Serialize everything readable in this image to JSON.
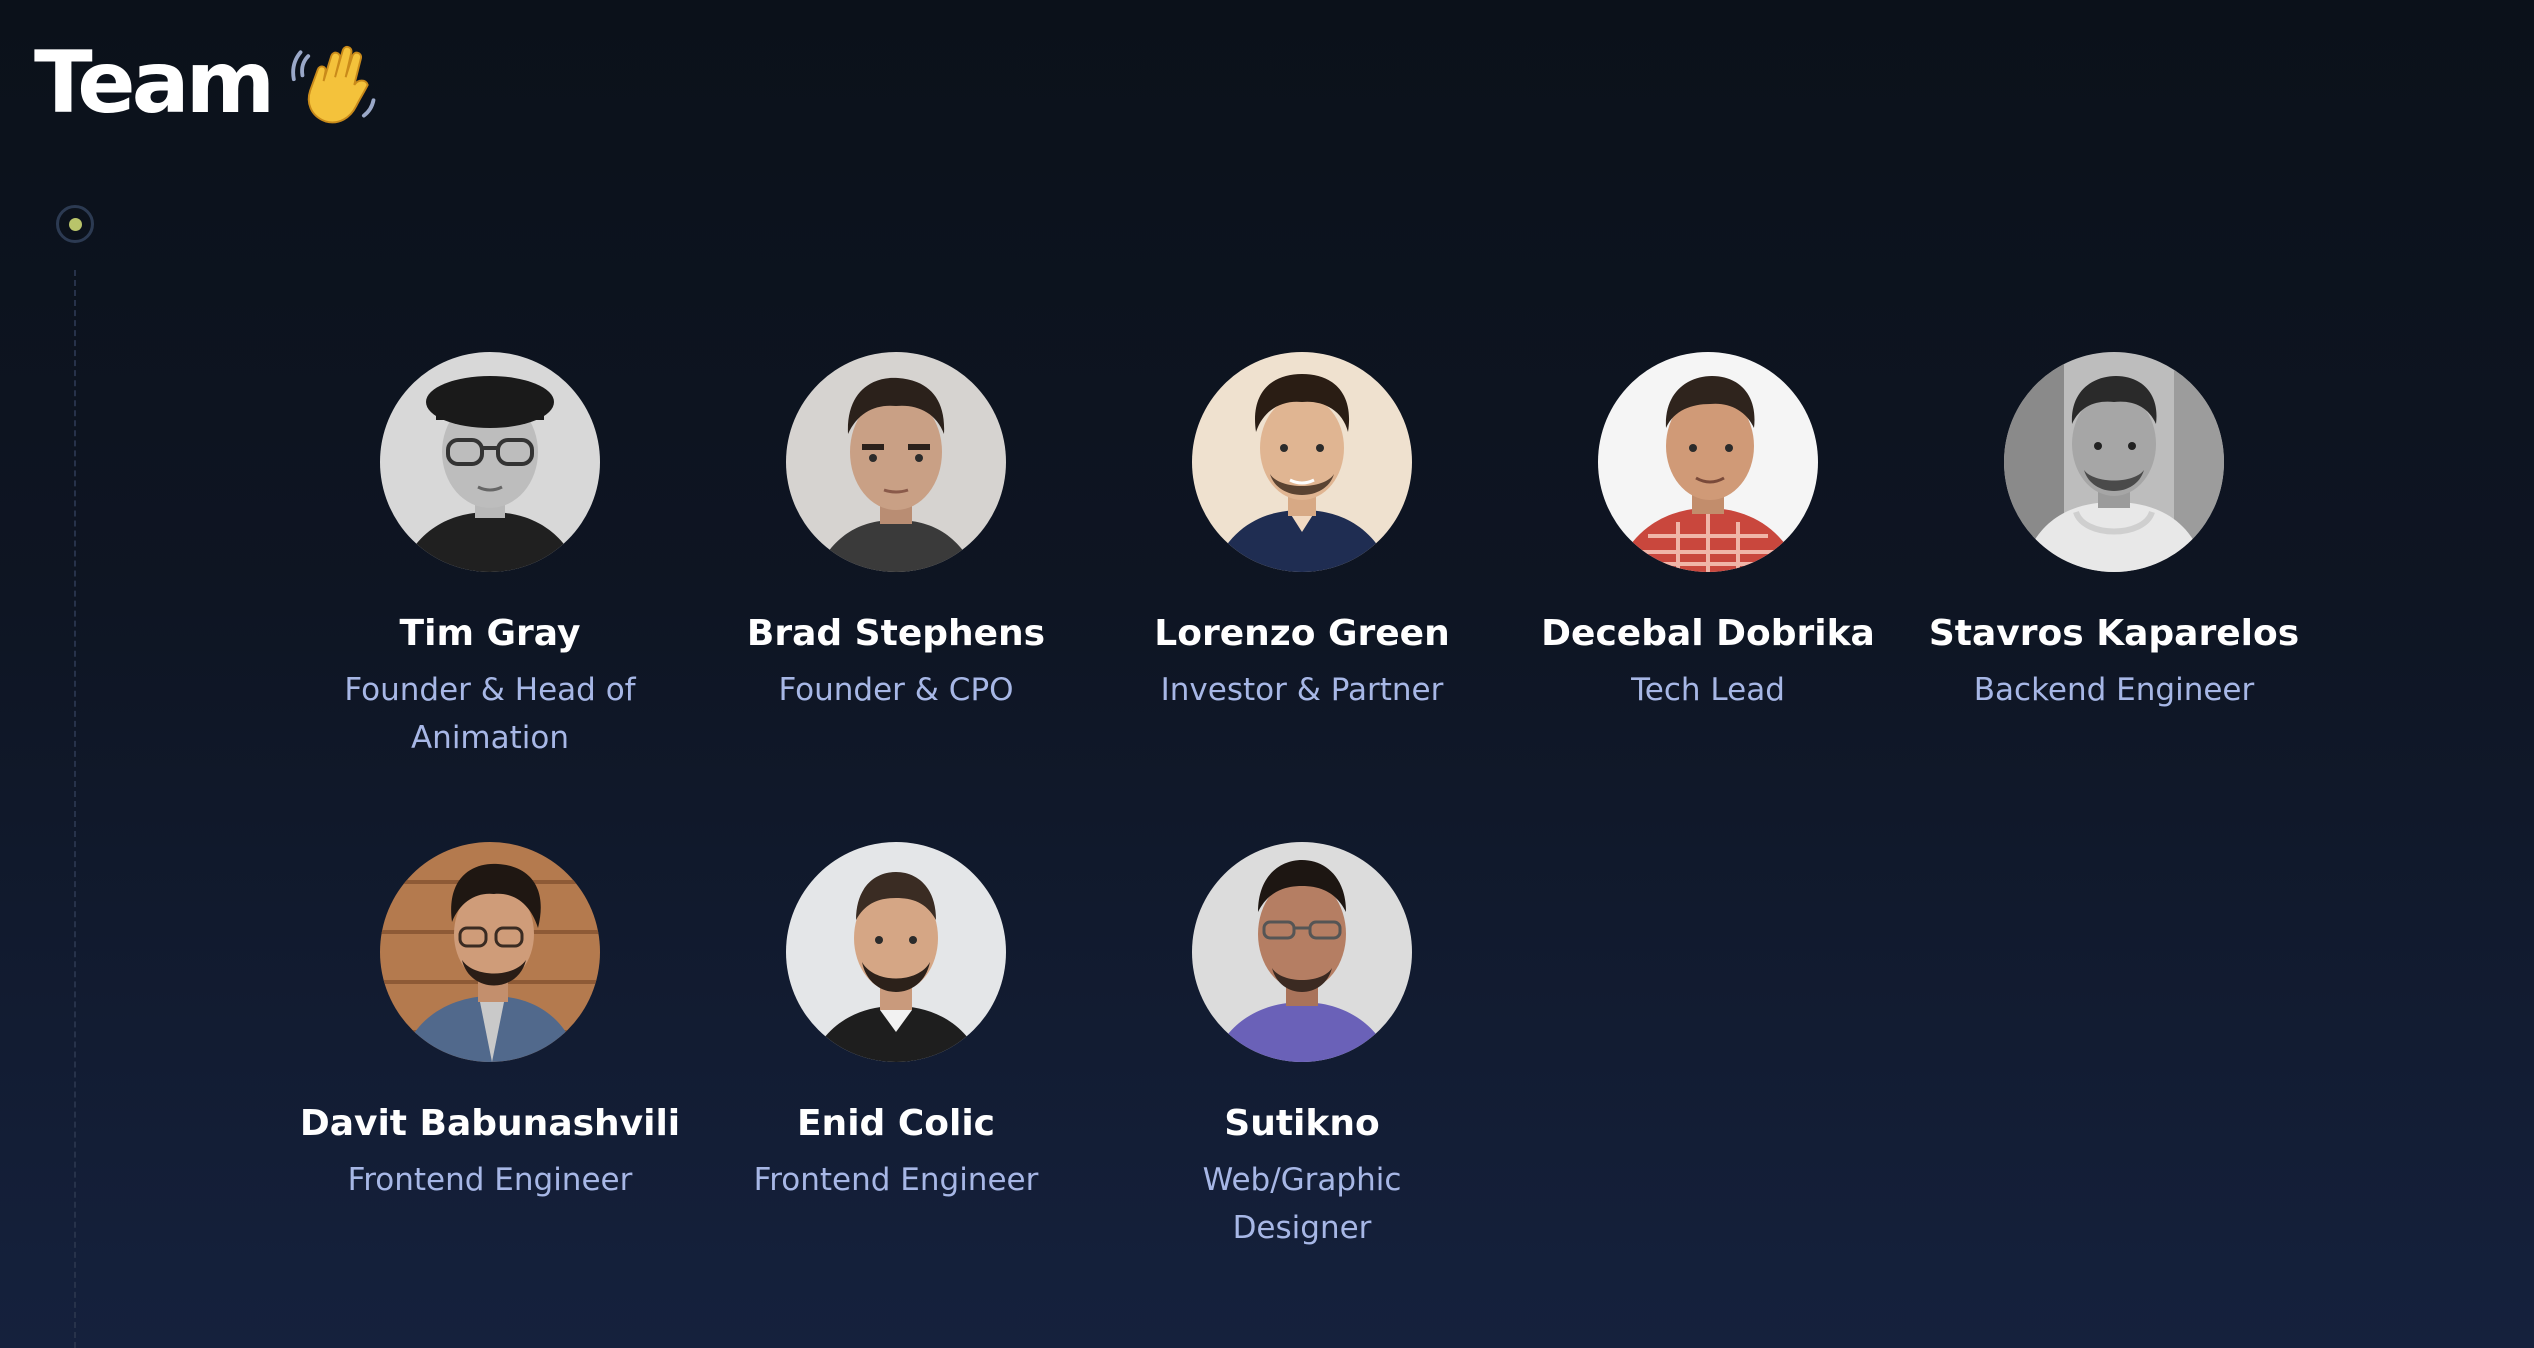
{
  "header": {
    "title": "Team",
    "emoji_icon": "waving-hand-icon"
  },
  "colors": {
    "background_top": "#0b111a",
    "background_bottom": "#15213d",
    "name_text": "#ffffff",
    "role_text": "#a7b7e6",
    "timeline_dot": "#b9c46a"
  },
  "team": {
    "members": [
      {
        "name": "Tim Gray",
        "role": "Founder & Head of Animation"
      },
      {
        "name": "Brad Stephens",
        "role": "Founder & CPO"
      },
      {
        "name": "Lorenzo Green",
        "role": "Investor & Partner"
      },
      {
        "name": "Decebal Dobrika",
        "role": "Tech Lead"
      },
      {
        "name": "Stavros Kaparelos",
        "role": "Backend Engineer"
      },
      {
        "name": "Davit Babunashvili",
        "role": "Frontend Engineer"
      },
      {
        "name": "Enid Colic",
        "role": "Frontend Engineer"
      },
      {
        "name": "Sutikno",
        "role": "Web/Graphic Designer"
      }
    ]
  }
}
